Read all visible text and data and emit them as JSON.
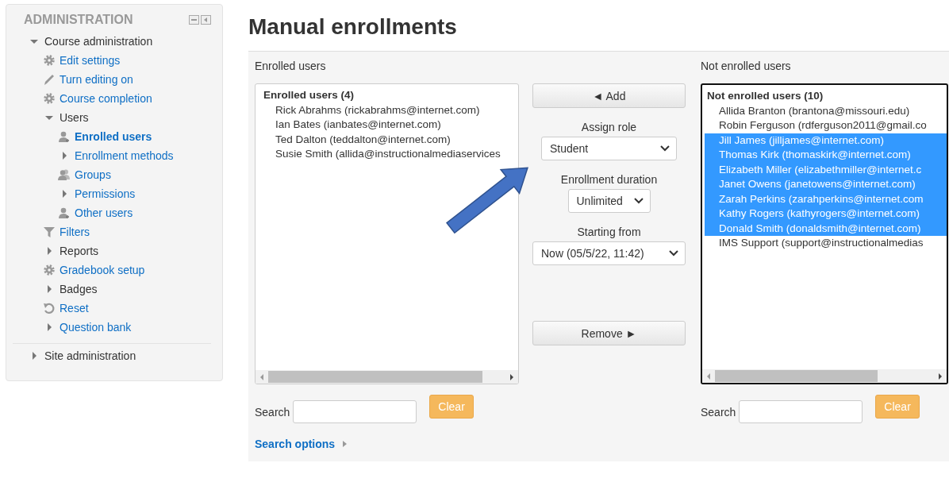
{
  "sidebar": {
    "title": "ADMINISTRATION",
    "items": [
      {
        "label": "Course administration",
        "kind": "branch",
        "expanded": true,
        "link": false,
        "current": false,
        "children": [
          {
            "label": "Edit settings",
            "kind": "settings",
            "link": true,
            "current": false
          },
          {
            "label": "Turn editing on",
            "kind": "edit",
            "link": true,
            "current": false
          },
          {
            "label": "Course completion",
            "kind": "settings",
            "link": true,
            "current": false
          },
          {
            "label": "Users",
            "kind": "branch",
            "expanded": true,
            "link": false,
            "current": false,
            "children": [
              {
                "label": "Enrolled users",
                "kind": "user",
                "link": true,
                "current": true
              },
              {
                "label": "Enrollment methods",
                "kind": "branch",
                "expanded": false,
                "link": true,
                "current": false
              },
              {
                "label": "Groups",
                "kind": "group",
                "link": true,
                "current": false
              },
              {
                "label": "Permissions",
                "kind": "branch",
                "expanded": false,
                "link": true,
                "current": false
              },
              {
                "label": "Other users",
                "kind": "user",
                "link": true,
                "current": false
              }
            ]
          },
          {
            "label": "Filters",
            "kind": "filter",
            "link": true,
            "current": false
          },
          {
            "label": "Reports",
            "kind": "branch",
            "expanded": false,
            "link": false,
            "current": false
          },
          {
            "label": "Gradebook setup",
            "kind": "settings",
            "link": true,
            "current": false
          },
          {
            "label": "Badges",
            "kind": "branch",
            "expanded": false,
            "link": false,
            "current": false
          },
          {
            "label": "Reset",
            "kind": "reset",
            "link": true,
            "current": false
          },
          {
            "label": "Question bank",
            "kind": "branch",
            "expanded": false,
            "link": true,
            "current": false
          }
        ]
      },
      {
        "label": "Site administration",
        "kind": "branch",
        "expanded": false,
        "link": false,
        "current": false
      }
    ]
  },
  "page_title": "Manual enrollments",
  "enrolled": {
    "caption": "Enrolled users",
    "group": "Enrolled users (4)",
    "users": [
      {
        "text": "Rick Abrahms (rickabrahms@internet.com)",
        "selected": false
      },
      {
        "text": "Ian Bates (ianbates@internet.com)",
        "selected": false
      },
      {
        "text": "Ted Dalton (teddalton@internet.com)",
        "selected": false
      },
      {
        "text": "Susie Smith (allida@instructionalmediaservices",
        "selected": false
      }
    ],
    "search_label": "Search",
    "clear": "Clear"
  },
  "controls": {
    "add": "◄ Add",
    "role_label": "Assign role",
    "role": "Student",
    "duration_label": "Enrollment duration",
    "duration": "Unlimited",
    "start_label": "Starting from",
    "start": "Now (05/5/22, 11:42)",
    "remove": "Remove ►"
  },
  "not_enrolled": {
    "caption": "Not enrolled users",
    "group": "Not enrolled users (10)",
    "users": [
      {
        "text": "Allida Branton (brantona@missouri.edu)",
        "selected": false
      },
      {
        "text": "Robin Ferguson (rdferguson2011@gmail.co",
        "selected": false
      },
      {
        "text": "Jill James (jilljames@internet.com)",
        "selected": true
      },
      {
        "text": "Thomas Kirk (thomaskirk@internet.com)",
        "selected": true
      },
      {
        "text": "Elizabeth Miller (elizabethmiller@internet.c",
        "selected": true
      },
      {
        "text": "Janet Owens (janetowens@internet.com)",
        "selected": true
      },
      {
        "text": "Zarah Perkins (zarahperkins@internet.com",
        "selected": true
      },
      {
        "text": "Kathy Rogers (kathyrogers@internet.com)",
        "selected": true
      },
      {
        "text": "Donald Smith (donaldsmith@internet.com)",
        "selected": true
      },
      {
        "text": "IMS Support (support@instructionalmedias",
        "selected": false
      }
    ],
    "search_label": "Search",
    "clear": "Clear"
  },
  "search_options": "Search options"
}
